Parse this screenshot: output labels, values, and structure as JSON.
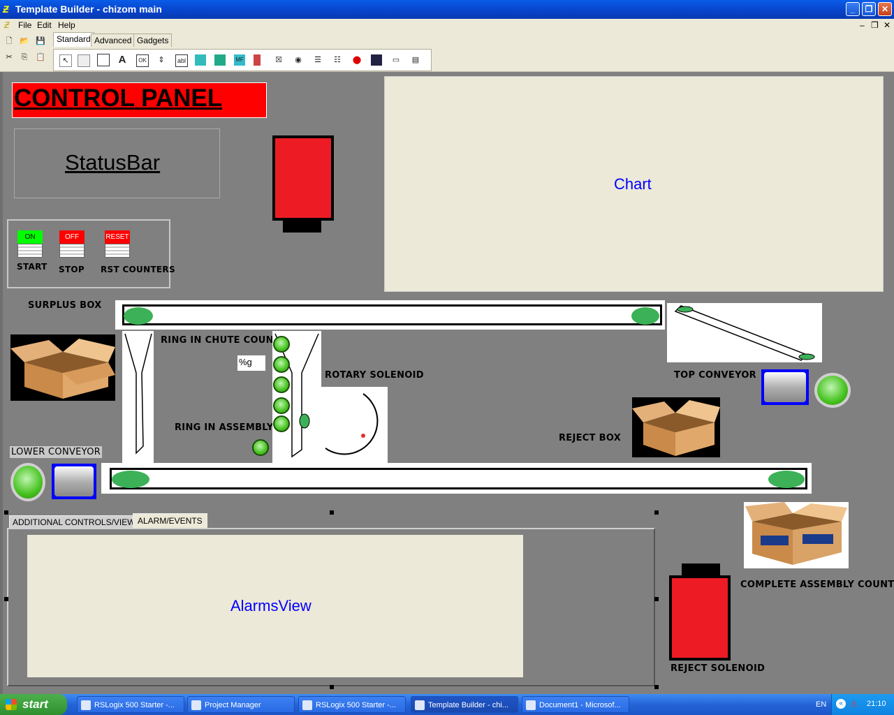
{
  "window": {
    "title": "Template Builder - chizom main"
  },
  "menu": [
    "File",
    "Edit",
    "Help"
  ],
  "toolbar_tabs": [
    "Standard",
    "Advanced",
    "Gadgets"
  ],
  "toolbar_icons": [
    "new-icon",
    "open-icon",
    "save-icon",
    "cut-icon",
    "copy-icon",
    "paste-icon",
    "pointer-icon",
    "panel-icon",
    "frame-icon",
    "text-icon",
    "button-icon",
    "spin-icon",
    "label-icon",
    "gauge-icon",
    "image-icon",
    "multistate-icon",
    "bar-icon",
    "checkbox-icon",
    "radio-icon",
    "list-icon",
    "combo-icon",
    "record-icon",
    "display-icon",
    "slider-icon",
    "window-icon"
  ],
  "control_panel": {
    "title": "CONTROL PANEL",
    "title_bg": "#ff0000"
  },
  "statusbar": {
    "label": "StatusBar"
  },
  "chart": {
    "label": "Chart"
  },
  "buttons": [
    {
      "cap": "ON",
      "caption_color": "#00ff00",
      "label": "START"
    },
    {
      "cap": "OFF",
      "caption_color": "#ff0000",
      "label": "STOP"
    },
    {
      "cap": "RESET",
      "caption_color": "#ff0000",
      "label": "RST COUNTERS"
    }
  ],
  "labels": {
    "surplus_box": "SURPLUS BOX",
    "ring_in_chute_count": "RING IN CHUTE COUNT",
    "chute_count_value": "%g",
    "rotary_solenoid": "ROTARY SOLENOID",
    "ring_in_assembly": "RING IN ASSEMBLY",
    "top_conveyor": "TOP CONVEYOR",
    "reject_box": "REJECT BOX",
    "lower_conveyor": "LOWER CONVEYOR",
    "complete_assembly_count": "COMPLETE ASSEMBLY COUNT",
    "reject_solenoid": "REJECT SOLENOID"
  },
  "bottom_tabs": [
    "ADDITIONAL CONTROLS/VIEWS",
    "ALARM/EVENTS"
  ],
  "alarms_view": {
    "label": "AlarmsView"
  },
  "colors": {
    "solenoid_red": "#ed1c24",
    "roller_green": "#3cb157",
    "accent_blue": "#0000ff"
  },
  "taskbar": {
    "start": "start",
    "tasks": [
      "RSLogix 500 Starter -...",
      "Project Manager",
      "RSLogix 500 Starter -...",
      "Template Builder - chi...",
      "Document1 - Microsof..."
    ],
    "lang": "EN",
    "clock": "21:10"
  }
}
